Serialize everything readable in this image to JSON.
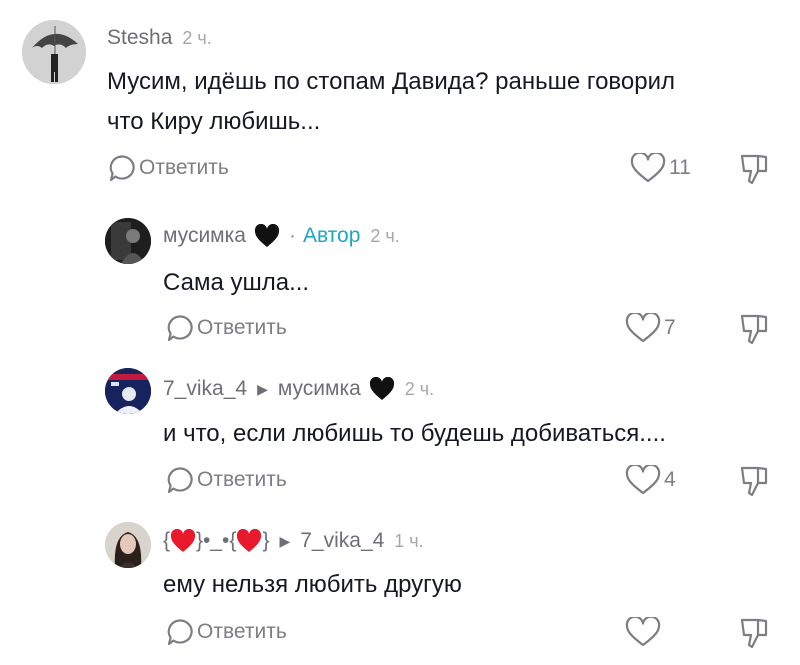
{
  "comments": [
    {
      "username": "Stesha",
      "time": "2 ч.",
      "text_lines": [
        "Мусим, идёшь по стопам Давида? раньше говорил",
        "что Киру любишь..."
      ],
      "reply_label": "Ответить",
      "likes": "11",
      "avatar_icon": "umbrella-figure-avatar"
    },
    {
      "username": "мусимка",
      "badge": "Автор",
      "time": "2 ч.",
      "text_lines": [
        "Сама ушла..."
      ],
      "reply_label": "Ответить",
      "likes": "7",
      "avatar_icon": "dark-portrait-avatar"
    },
    {
      "username": "7_vika_4",
      "reply_to": "мусимка",
      "time": "2 ч.",
      "text_lines": [
        "и что, если любишь то будешь добиваться...."
      ],
      "reply_label": "Ответить",
      "likes": "4",
      "avatar_icon": "neon-portrait-avatar"
    },
    {
      "username_parts": [
        "{",
        "}•_•{",
        "}"
      ],
      "reply_to": "7_vika_4",
      "time": "1 ч.",
      "text_lines": [
        "ему нельзя любить другую"
      ],
      "reply_label": "Ответить",
      "likes": "",
      "avatar_icon": "portrait-avatar"
    }
  ],
  "colors": {
    "author_badge": "#20a7bf",
    "secondary_text": "#6e6f76",
    "muted_text": "#a6a7ab",
    "red_heart": "#e8192c"
  }
}
